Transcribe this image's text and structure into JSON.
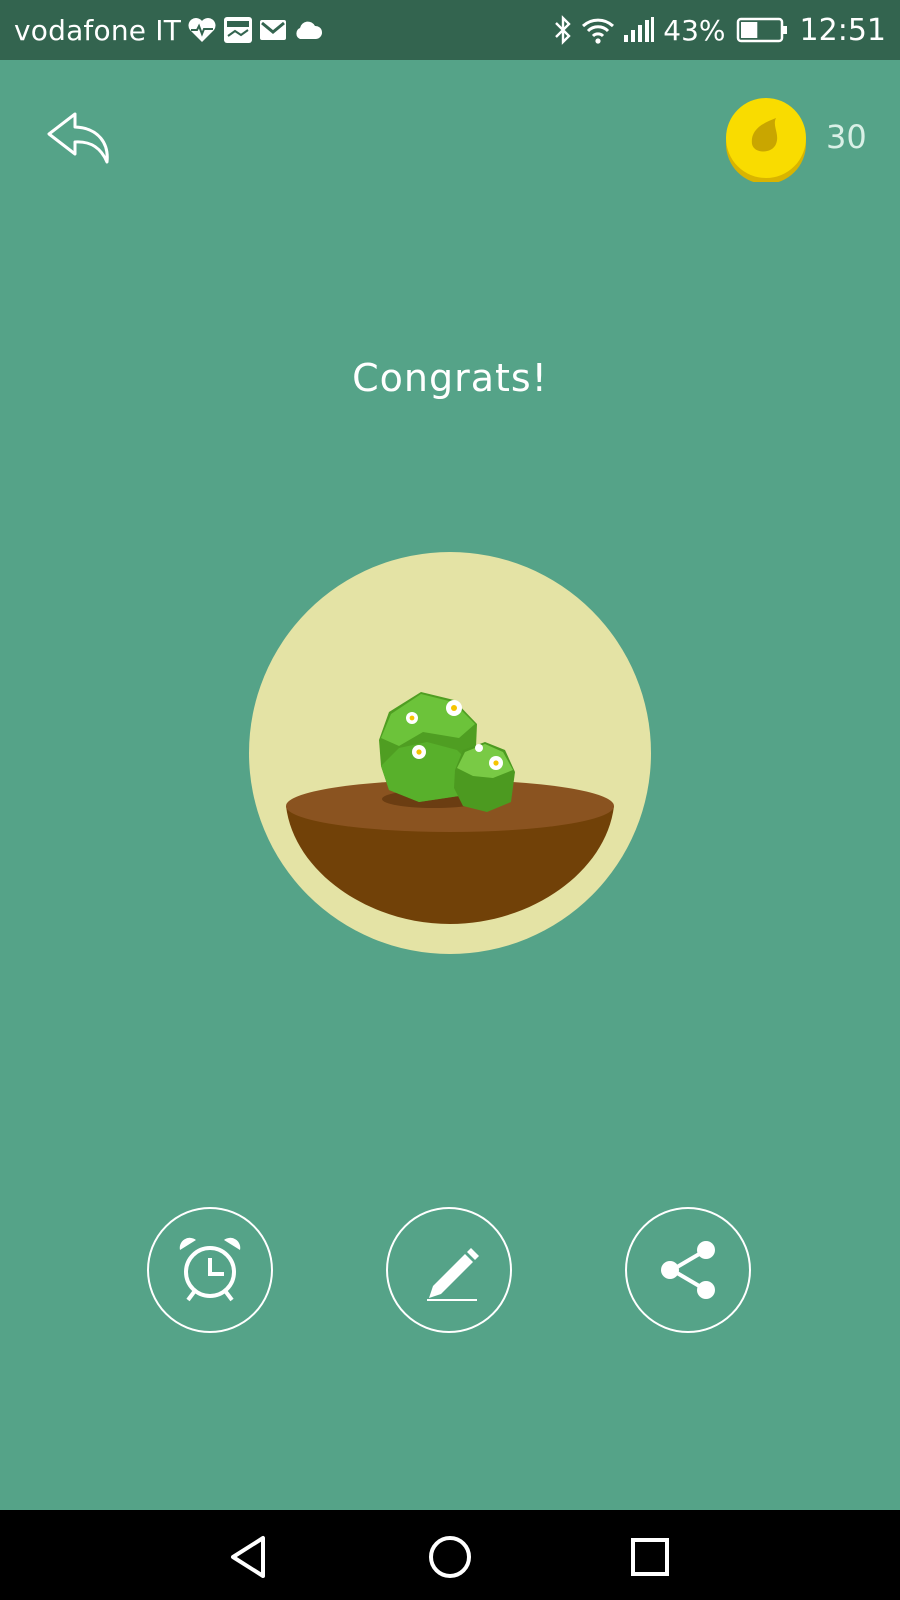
{
  "status_bar": {
    "carrier": "vodafone IT",
    "battery_percent": "43%",
    "time": "12:51",
    "battery_level": 0.43,
    "left_icons": [
      "heart-pulse-icon",
      "photo-icon",
      "gmail-icon",
      "cloud-icon"
    ],
    "right_icons": [
      "bluetooth-icon",
      "wifi-icon",
      "signal-icon",
      "battery-icon"
    ]
  },
  "header": {
    "back_icon": "reply-arrow-icon",
    "coin_icon": "seed-coin-icon",
    "coin_count": "30"
  },
  "main": {
    "title": "Congrats!",
    "illustration": "bush-in-pot-icon"
  },
  "actions": [
    {
      "name": "timer",
      "icon": "alarm-clock-icon"
    },
    {
      "name": "note",
      "icon": "pencil-icon"
    },
    {
      "name": "share",
      "icon": "share-icon"
    }
  ],
  "nav_bar": {
    "back_icon": "triangle-back-icon",
    "home_icon": "circle-home-icon",
    "recent_icon": "square-recent-icon"
  },
  "colors": {
    "background": "#55a388",
    "status_bar": "#33644f",
    "pot_circle": "#e4e3a5",
    "soil": "#8a5320",
    "bowl": "#714108",
    "bush": "#59b030",
    "coin": "#f9dc00"
  }
}
